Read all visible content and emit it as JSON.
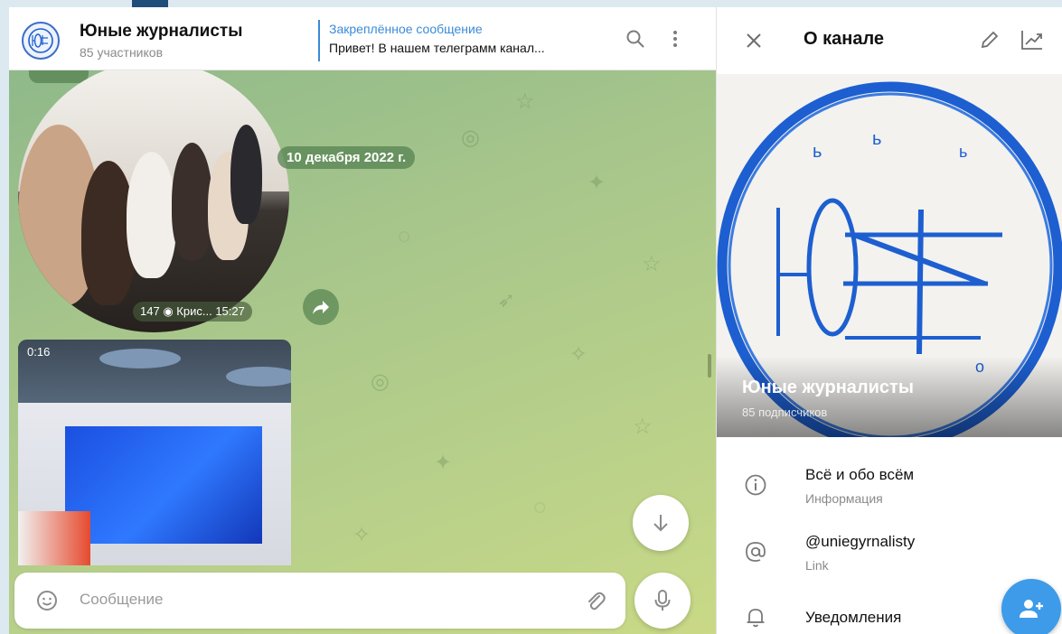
{
  "chat": {
    "title": "Юные журналисты",
    "subtitle": "85 участников",
    "pinned": {
      "title": "Закреплённое сообщение",
      "text": "Привет! В нашем телеграмм канал..."
    },
    "date_label": "10 декабря 2022 г.",
    "round_video": {
      "views": "147",
      "author": "Крис...",
      "time": "15:27"
    },
    "video": {
      "duration": "0:16"
    },
    "input": {
      "placeholder": "Сообщение",
      "value": ""
    },
    "icons": {
      "search": "search-icon",
      "menu": "more-vertical-icon",
      "share": "share-icon",
      "scroll_down": "arrow-down-icon",
      "emoji": "emoji-icon",
      "attach": "paperclip-icon",
      "mic": "microphone-icon"
    }
  },
  "info_panel": {
    "title": "О канале",
    "channel_name": "Юные журналисты",
    "subscribers": "85 подписчиков",
    "rows": [
      {
        "main": "Всё и обо всём",
        "sub": "Информация",
        "icon": "info-icon"
      },
      {
        "main": "@uniegyrnalisty",
        "sub": "Link",
        "icon": "at-icon"
      },
      {
        "main": "Уведомления",
        "sub": "",
        "icon": "bell-icon"
      }
    ],
    "icons": {
      "close": "close-icon",
      "edit": "pencil-icon",
      "stats": "statistics-icon",
      "fab": "add-user-icon"
    }
  },
  "colors": {
    "accent": "#3a8bd8",
    "fab": "#3d9be9",
    "chat_background": "#a9c78b",
    "logo_blue": "#1d5fd0"
  }
}
